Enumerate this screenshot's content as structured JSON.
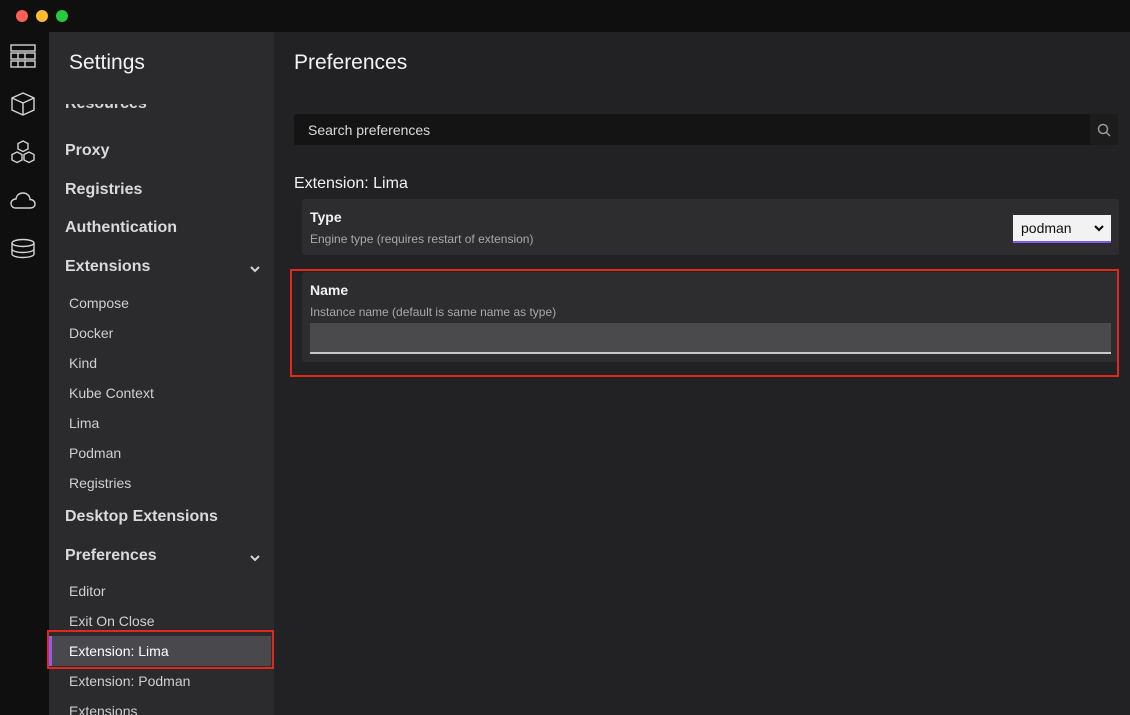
{
  "window": {
    "controls": [
      "close",
      "minimize",
      "maximize"
    ]
  },
  "iconbar": {
    "icons": [
      "dashboard-icon",
      "containers-icon",
      "pods-icon",
      "cloud-icon",
      "volumes-icon"
    ]
  },
  "sidebar": {
    "title": "Settings",
    "cut_item": "Resources",
    "categories": {
      "proxy": "Proxy",
      "registries": "Registries",
      "authentication": "Authentication",
      "extensions": "Extensions",
      "desktop_extensions": "Desktop Extensions",
      "preferences": "Preferences"
    },
    "extensions_items": [
      "Compose",
      "Docker",
      "Kind",
      "Kube Context",
      "Lima",
      "Podman",
      "Registries"
    ],
    "preferences_items": [
      "Editor",
      "Exit On Close",
      "Extension: Lima",
      "Extension: Podman",
      "Extensions"
    ],
    "active_item": "Extension: Lima"
  },
  "main": {
    "title": "Preferences",
    "search": {
      "placeholder": "Search preferences",
      "value": ""
    },
    "section_title": "Extension: Lima",
    "type_setting": {
      "label": "Type",
      "description": "Engine type (requires restart of extension)",
      "value": "podman"
    },
    "name_setting": {
      "label": "Name",
      "description": "Instance name (default is same name as type)",
      "value": ""
    }
  },
  "colors": {
    "accent": "#8b5cf6",
    "highlight": "#e0291b"
  }
}
